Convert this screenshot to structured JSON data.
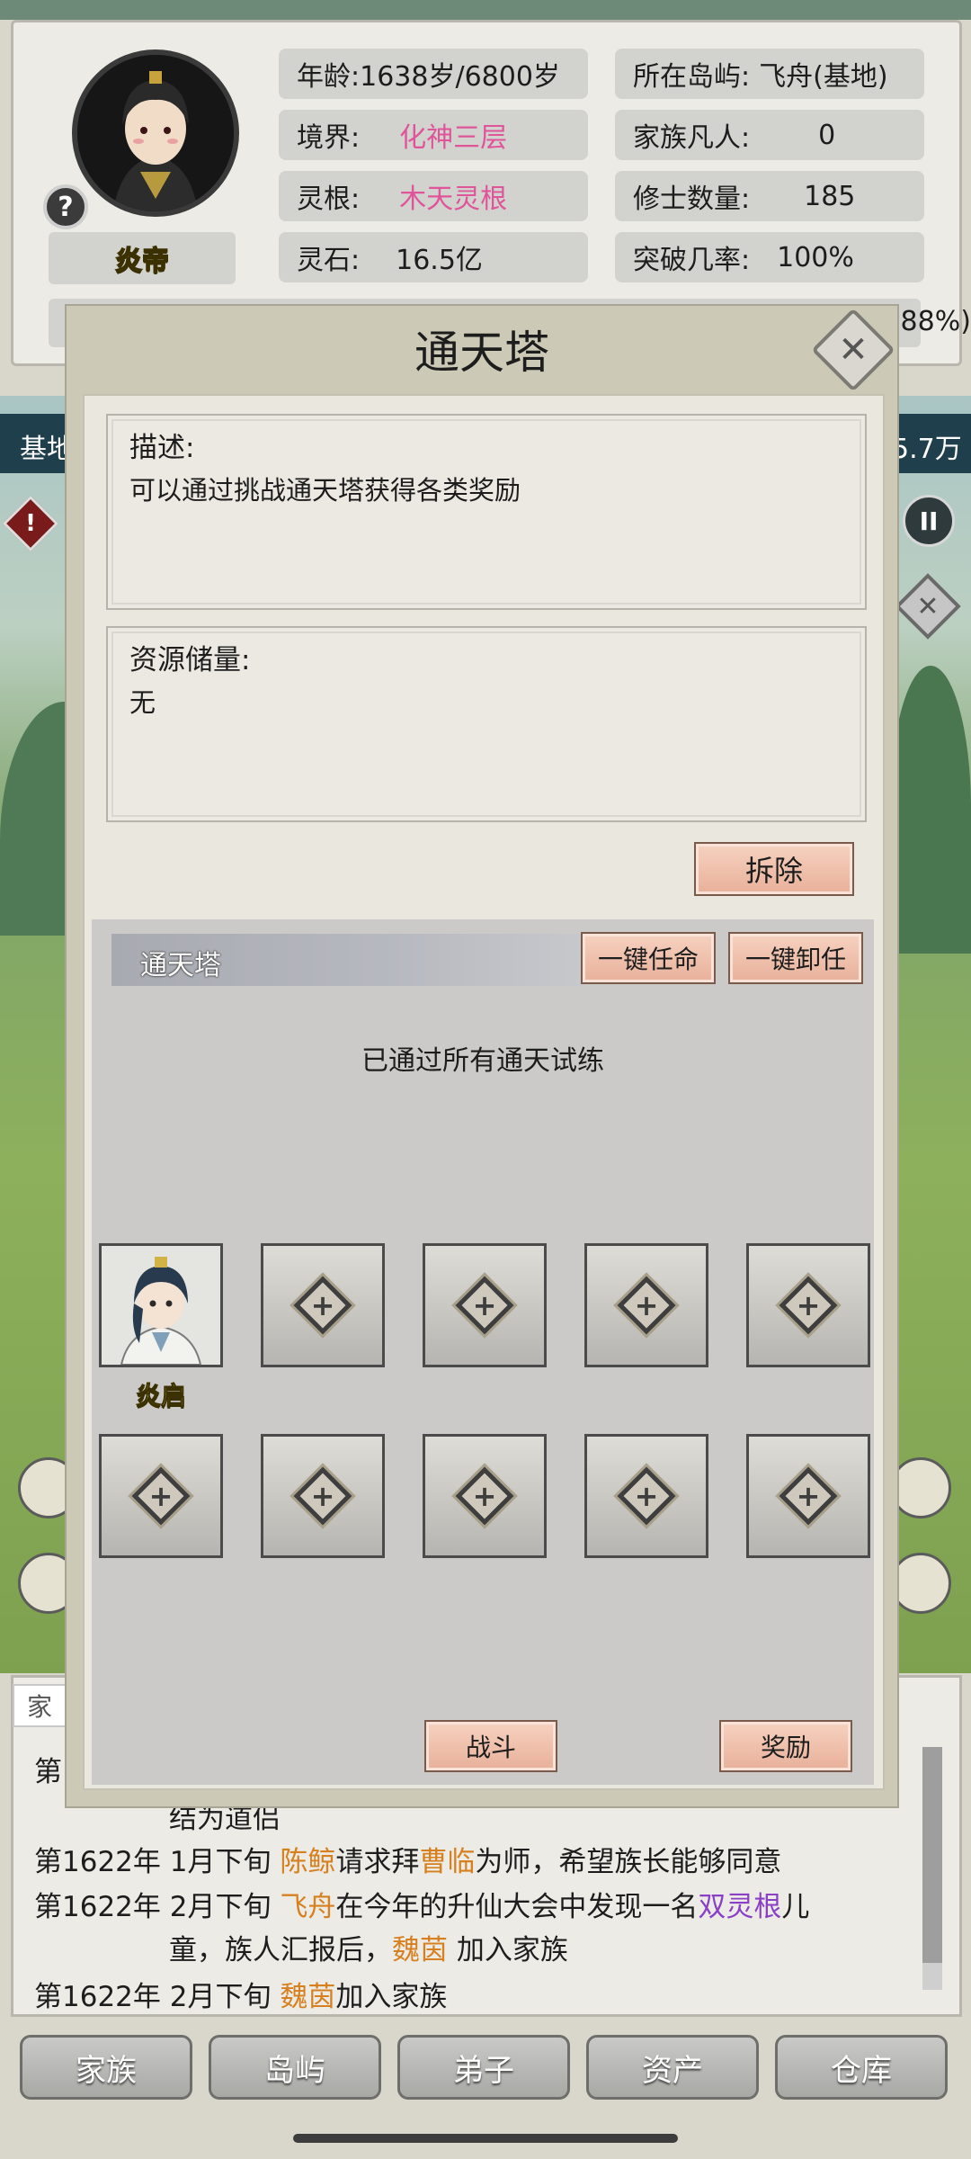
{
  "profile": {
    "name": "炎帝",
    "help": "?",
    "stats": [
      {
        "key": "年龄:",
        "value": "1638岁/6800岁"
      },
      {
        "key": "所在岛屿:",
        "value": "飞舟(基地)"
      },
      {
        "key": "境界:",
        "value": "化神三层"
      },
      {
        "key": "家族凡人:",
        "value": "0"
      },
      {
        "key": "灵根:",
        "value": "木天灵根"
      },
      {
        "key": "修士数量:",
        "value": "185"
      },
      {
        "key": "灵石:",
        "value": "16.5亿"
      },
      {
        "key": "突破几率:",
        "value": "100%"
      }
    ],
    "partial_pct": ".88%)"
  },
  "map": {
    "left_label": "基地",
    "right_label": "5.7万",
    "pause_icon": "pause-icon",
    "warn_icon": "warning-icon"
  },
  "modal": {
    "title": "通天塔",
    "close_icon": "close-icon",
    "desc_label": "描述:",
    "desc_text": "可以通过挑战通天塔获得各类奖励",
    "resource_label": "资源储量:",
    "resource_text": "无",
    "demolish_button": "拆除",
    "tower_header": "通天塔",
    "appoint_all_button": "一键任命",
    "dismiss_all_button": "一键卸任",
    "status_text": "已通过所有通天试练",
    "assigned": {
      "name": "炎启"
    },
    "battle_button": "战斗",
    "reward_button": "奖励"
  },
  "log": {
    "tab_label": "家",
    "lines": [
      {
        "prefix": "第",
        "parts": []
      },
      {
        "prefix": "",
        "parts": [
          {
            "t": "结为道侣",
            "c": ""
          }
        ]
      },
      {
        "prefix": "第1622年 1月下旬 ",
        "parts": [
          {
            "t": "陈鲸",
            "c": "o"
          },
          {
            "t": "请求拜",
            "c": ""
          },
          {
            "t": "曹临",
            "c": "o"
          },
          {
            "t": "为师，希望族长能够同意",
            "c": ""
          }
        ]
      },
      {
        "prefix": "第1622年 2月下旬 ",
        "parts": [
          {
            "t": "飞舟",
            "c": "o"
          },
          {
            "t": "在今年的升仙大会中发现一名",
            "c": ""
          },
          {
            "t": "双灵根",
            "c": "p"
          },
          {
            "t": "儿",
            "c": ""
          }
        ]
      },
      {
        "prefix": "",
        "parts": [
          {
            "t": "童，族人汇报后，",
            "c": ""
          },
          {
            "t": "魏茵",
            "c": "o"
          },
          {
            "t": " 加入家族",
            "c": ""
          }
        ]
      },
      {
        "prefix": "第1622年 2月下旬 ",
        "parts": [
          {
            "t": "魏茵",
            "c": "o"
          },
          {
            "t": "加入家族",
            "c": ""
          }
        ]
      }
    ]
  },
  "nav": [
    "家族",
    "岛屿",
    "弟子",
    "资产",
    "仓库"
  ],
  "colors": {
    "accent_pink": "#e0549a",
    "name_orange": "#d7801f",
    "purple": "#8a3fc6",
    "hero_name_yellow": "#f3e24b"
  }
}
